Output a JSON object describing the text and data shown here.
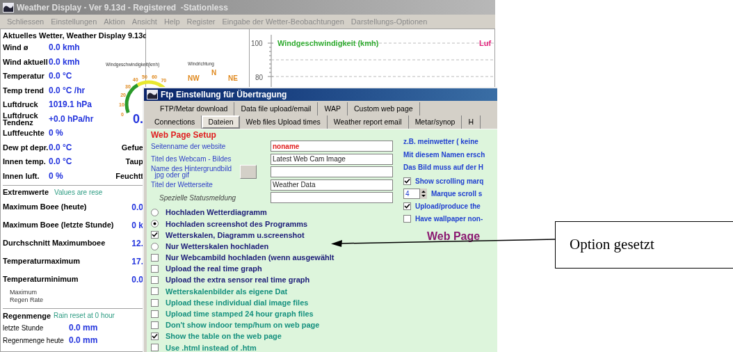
{
  "window": {
    "title": "Weather Display - Ver 9.13d - Registered  -Stationless"
  },
  "menu": [
    "Schliessen",
    "Einstellungen",
    "Aktion",
    "Ansicht",
    "Help",
    "Register",
    "Eingabe der Wetter-Beobachtungen",
    "Darstellungs-Optionen"
  ],
  "current": {
    "title": "Aktuelles Wetter, Weather Display 9.13d",
    "rows": [
      {
        "label": "Wind ø",
        "value": "0.0 kmh"
      },
      {
        "label": "Wind aktuell",
        "value": "0.0 kmh"
      },
      {
        "label": "Temperatur",
        "value": "0.0 °C"
      },
      {
        "label": "Temp trend",
        "value": "0.0 °C /hr"
      },
      {
        "label": "Luftdruck",
        "value": "1019.1 hPa"
      },
      {
        "label": "Luftdruck\nTendenz",
        "value": "+0.0 hPa/hr",
        "extra": {
          "text": "0.",
          "large": true
        }
      },
      {
        "label": "Luftfeuchte",
        "value": "0 %"
      },
      {
        "label": "Dew pt depr.",
        "value": "0.0 °C",
        "extra": {
          "text": "Gefue",
          "large": false
        }
      },
      {
        "label": "Innen temp.",
        "value": "0.0 °C",
        "extra": {
          "text": "Taup",
          "large": false
        }
      },
      {
        "label": "Innen luft.",
        "value": "0 %",
        "extra": {
          "text": "Feuchtt",
          "large": false
        }
      }
    ]
  },
  "extremes": {
    "title": "Extremwerte",
    "note": "Values are rese",
    "rows": [
      {
        "label": "Maximum Boee (heute)",
        "value": "0.0"
      },
      {
        "label": "Maximum Boee (letzte Stunde)",
        "value": "0 k"
      },
      {
        "label": "Durchschnitt Maximumboee",
        "value": "12."
      },
      {
        "label": "Temperaturmaximum",
        "value": "17."
      },
      {
        "label": "Temperaturminimum",
        "value": "0.0"
      }
    ],
    "small_label": "Maximum\nRegen Rate"
  },
  "rain": {
    "title": "Regenmenge",
    "note": "Rain reset at 0 hour",
    "rows": [
      {
        "label": "letzte Stunde",
        "value": "0.0 mm"
      },
      {
        "label": "Regenmenge heute",
        "value": "0.0 mm"
      }
    ]
  },
  "gauge": {
    "speed_label": "Windgeschwindigkeit(kmh)",
    "direction_label": "Windrichtung",
    "ticks": [
      "50",
      "60",
      "40",
      "70",
      "30",
      "20",
      "10",
      "0"
    ],
    "compass": [
      "NW",
      "N",
      "NE"
    ]
  },
  "chart": {
    "y_labels": [
      "100",
      "80"
    ],
    "series_labels": [
      {
        "text": "Windgeschwindigkeit (kmh)",
        "color": "#2faa2f"
      },
      {
        "text": "Luf",
        "color": "#e0207a"
      }
    ]
  },
  "dialog": {
    "title": "Ftp Einstellung für Übertragung",
    "tab_rows": [
      [
        {
          "label": "FTP/Metar download",
          "selected": false
        },
        {
          "label": "Data file upload/email",
          "selected": false
        },
        {
          "label": "WAP",
          "selected": false
        },
        {
          "label": "Custom web page",
          "selected": false
        }
      ],
      [
        {
          "label": "Connections",
          "selected": false
        },
        {
          "label": "Dateien",
          "selected": true
        },
        {
          "label": "Web files Upload times",
          "selected": false
        },
        {
          "label": "Weather report email",
          "selected": false
        },
        {
          "label": "Metar/synop",
          "selected": false
        },
        {
          "label": "H",
          "selected": false
        }
      ]
    ],
    "group_title": "Web Page Setup",
    "fields": [
      {
        "label": "Seitenname der website",
        "value": "noname",
        "highlight": true
      },
      {
        "label": "Titel des Webcam - Bildes",
        "value": "Latest Web Cam Image",
        "highlight": false
      },
      {
        "label": "Name des Hintergrundbild\n  jpg oder gif",
        "highlight": false,
        "has_button": true
      },
      {
        "label": "Titel der Wetterseite",
        "value": "Weather Data",
        "highlight": false
      },
      {
        "label": "Spezielle Statusmeldung",
        "highlight": false,
        "italic": true
      }
    ],
    "notes": [
      "z.B. meinwetter ( keine",
      "Mit diesem Namen ersch",
      "Das Bild muss auf der H"
    ],
    "side_options": [
      {
        "kind": "checkbox",
        "label": "Show scrolling marq",
        "checked": true
      },
      {
        "kind": "spinner",
        "label": "Marque scroll s",
        "setting": "4"
      },
      {
        "kind": "checkbox",
        "label": "Upload/produce the",
        "checked": true
      },
      {
        "kind": "checkbox",
        "label": "Have wallpaper non-",
        "checked": false
      }
    ],
    "big_label": "Web Page",
    "options": [
      {
        "kind": "radio",
        "label": "Hochladen Wetterdiagramm",
        "checked": false,
        "color": "#1c1c78"
      },
      {
        "kind": "radio",
        "label": "Hochladen screenshot des Programms",
        "checked": true,
        "color": "#1c1c78"
      },
      {
        "kind": "checkbox",
        "label": "Wetterskalen, Diagramm u.screenshot",
        "checked": true,
        "color": "#1c1c78"
      },
      {
        "kind": "radio",
        "label": "Nur Wetterskalen hochladen",
        "checked": false,
        "color": "#1c1c78"
      },
      {
        "kind": "checkbox",
        "label": "Nur Webcambild hochladen (wenn ausgewählt",
        "checked": false,
        "color": "#1c1c78"
      },
      {
        "kind": "checkbox",
        "label": "Upload the real time graph",
        "checked": false,
        "color": "#1c1c78"
      },
      {
        "kind": "checkbox",
        "label": "Upload the extra sensor real time graph",
        "checked": false,
        "color": "#1c1c78"
      },
      {
        "kind": "checkbox",
        "label": "Wetterskalenbilder als eigene Dat",
        "checked": false,
        "color": "#14907e"
      },
      {
        "kind": "checkbox",
        "label": "Upload these individual dial image files",
        "checked": false,
        "color": "#14907e"
      },
      {
        "kind": "checkbox",
        "label": "Upload time stamped 24 hour graph files",
        "checked": false,
        "color": "#14907e"
      },
      {
        "kind": "checkbox",
        "label": "Don't show indoor temp/hum on web page",
        "checked": false,
        "color": "#14907e"
      },
      {
        "kind": "checkbox",
        "label": "Show the table on the web page",
        "checked": true,
        "color": "#14907e"
      },
      {
        "kind": "checkbox",
        "label": "Use .html instead of .htm",
        "checked": false,
        "color": "#14907e"
      }
    ]
  },
  "callout": {
    "text": "Option gesetzt"
  }
}
